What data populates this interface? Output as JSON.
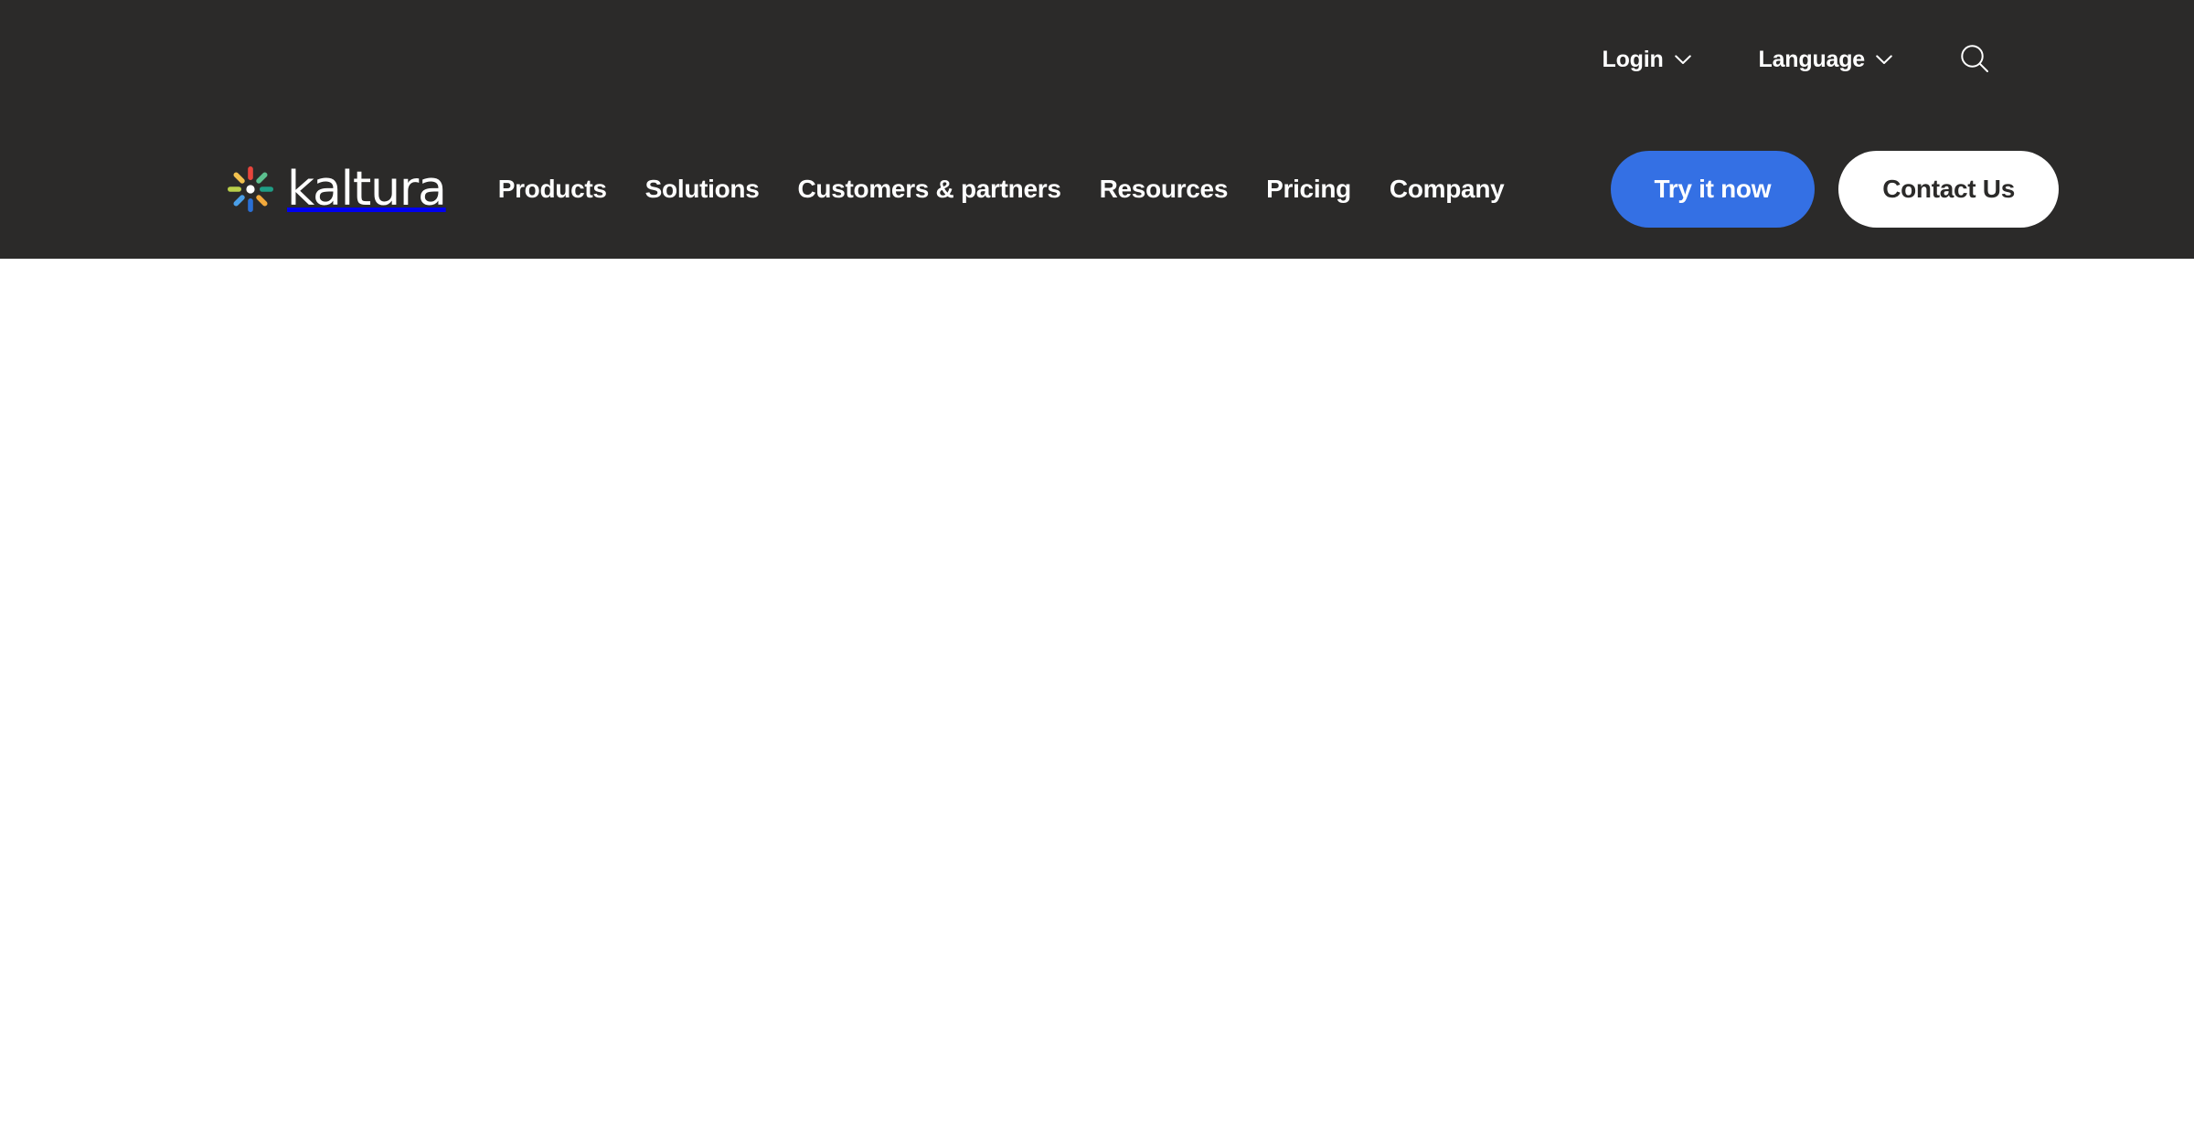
{
  "site": {
    "brand_name": "kaltura",
    "header_bg": "#2b2a29",
    "body_bg": "#ffffff",
    "accent_blue": "#3470e4"
  },
  "header": {
    "utility_nav": {
      "items": [
        {
          "label": "Login",
          "icon": "chevron-down-icon"
        },
        {
          "label": "Language",
          "icon": "chevron-down-icon"
        }
      ],
      "search_icon": "search-icon"
    },
    "logo": {
      "wordmark": "kaltura",
      "mark_icon": "kaltura-starburst-icon",
      "ray_colors": {
        "top": "#e8453c",
        "upper_right": "#5cbf8e",
        "right": "#1f9e86",
        "lower_right": "#f2a93b",
        "bottom": "#2a6fd4",
        "lower_left": "#4a9fe8",
        "left": "#b9cf4a",
        "upper_left": "#f2c14e",
        "center": "#ffffff"
      }
    },
    "primary_nav": {
      "items": [
        {
          "label": "Products"
        },
        {
          "label": "Solutions"
        },
        {
          "label": "Customers & partners"
        },
        {
          "label": "Resources"
        },
        {
          "label": "Pricing"
        },
        {
          "label": "Company"
        }
      ]
    },
    "cta": {
      "primary_label": "Try it now",
      "secondary_label": "Contact Us"
    }
  },
  "main": {
    "content": ""
  }
}
